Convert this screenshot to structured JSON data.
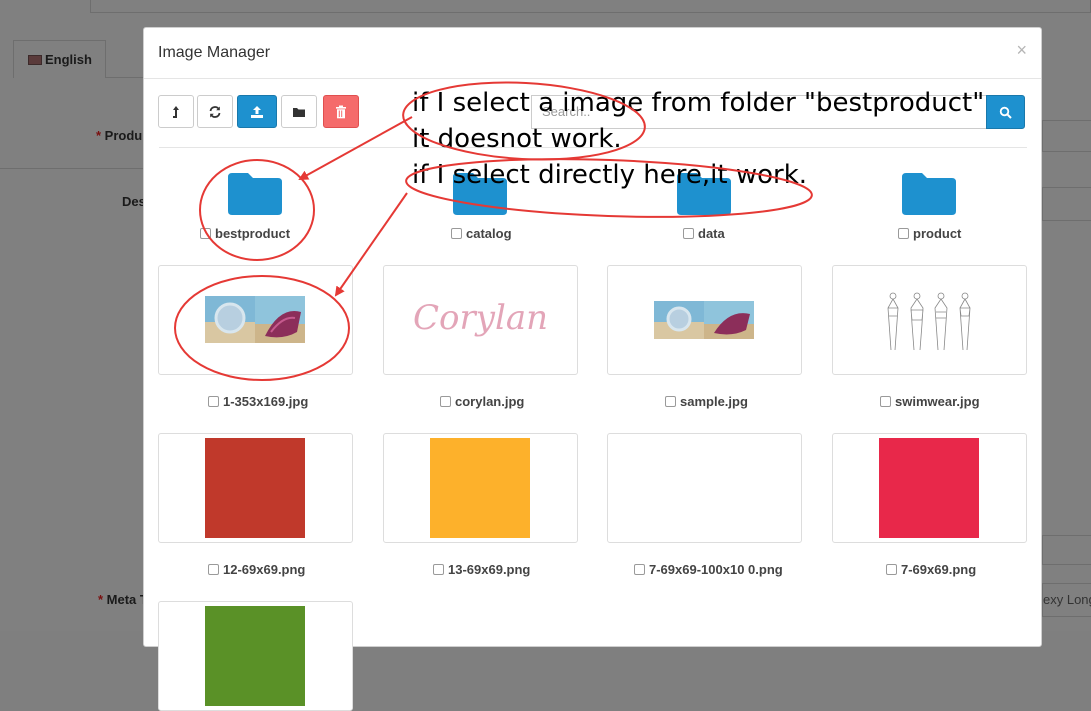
{
  "background": {
    "language_tab": "English",
    "product_label_partial": "Produ",
    "description_label_partial": "Des",
    "meta_label_partial": "Meta T",
    "right_field_partial": "exy Long"
  },
  "modal": {
    "title": "Image Manager",
    "close_glyph": "×",
    "search_placeholder": "Search.."
  },
  "toolbar": {
    "icons": [
      "level-up-icon",
      "refresh-icon",
      "upload-icon",
      "folder-icon",
      "trash-icon"
    ]
  },
  "folders": [
    {
      "name": "bestproduct"
    },
    {
      "name": "catalog"
    },
    {
      "name": "data"
    },
    {
      "name": "product"
    }
  ],
  "images": [
    {
      "name": "1-353x169.jpg",
      "kind": "beach"
    },
    {
      "name": "corylan.jpg",
      "kind": "logo",
      "logo_text": "Corylan"
    },
    {
      "name": "sample.jpg",
      "kind": "beach"
    },
    {
      "name": "swimwear.jpg",
      "kind": "sketch"
    },
    {
      "name": "12-69x69.png",
      "kind": "color",
      "color": "#c0392b"
    },
    {
      "name": "13-69x69.png",
      "kind": "color",
      "color": "#fdb12b"
    },
    {
      "name": "7-69x69-100x10 0.png",
      "kind": "blank"
    },
    {
      "name": "7-69x69.png",
      "kind": "color",
      "color": "#e8284a"
    },
    {
      "name": "",
      "kind": "color",
      "color": "#5a9127"
    }
  ],
  "annotation": {
    "line1": "if I select a image from folder \"bestproduct\"",
    "line2": "it doesnot work.",
    "line3": "if I select directly here,it work.",
    "color": "#e53935"
  },
  "colors": {
    "primary": "#1e91cf",
    "danger": "#f56b6b",
    "folder": "#1e91cf"
  }
}
